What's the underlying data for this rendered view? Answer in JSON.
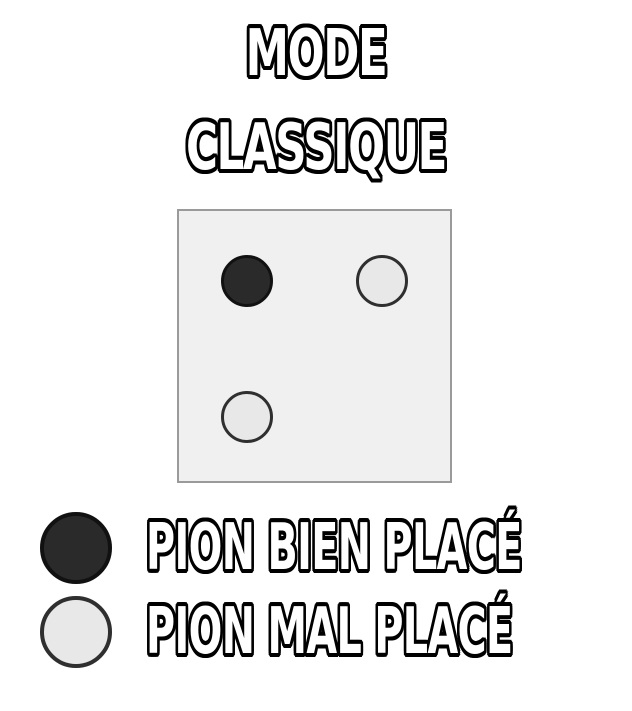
{
  "title": {
    "line1": "MODE",
    "line2": "CLASSIQUE"
  },
  "board": {
    "pegs": [
      {
        "type": "bien-place",
        "color": "#2a2a2a"
      },
      {
        "type": "mal-place",
        "color": "#e8e8e8"
      },
      {
        "type": "mal-place",
        "color": "#e8e8e8"
      }
    ]
  },
  "legend": {
    "items": [
      {
        "label": "PION BIEN PLACÉ",
        "icon": "dark-peg-icon",
        "color": "#2a2a2a"
      },
      {
        "label": "PION MAL PLACÉ",
        "icon": "light-peg-icon",
        "color": "#e8e8e8"
      }
    ]
  }
}
